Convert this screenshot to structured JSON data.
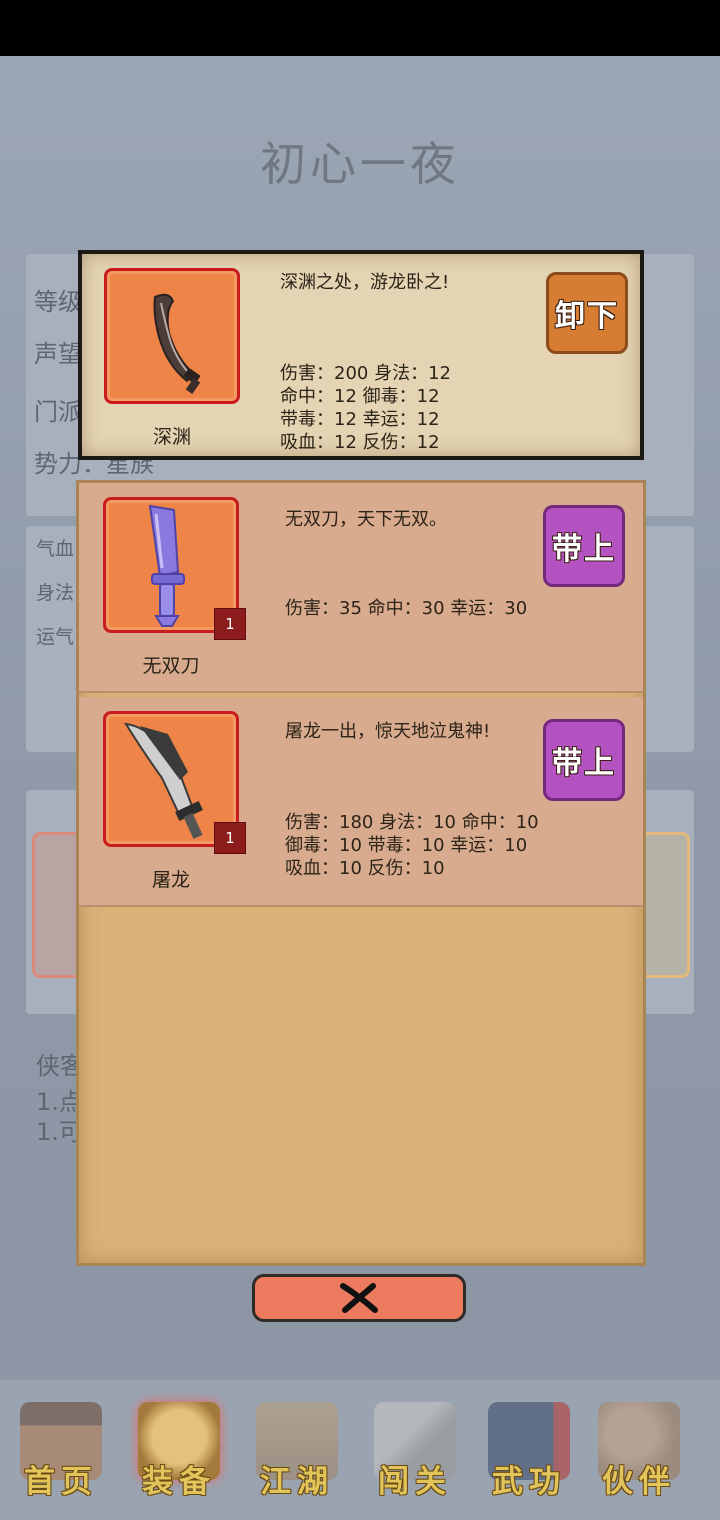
{
  "background": {
    "title": "初心一夜",
    "info_labels": [
      "等级",
      "声望",
      "门派",
      "势力：星族"
    ],
    "attr_labels": [
      "气血",
      "身法",
      "运气"
    ],
    "tips_labels": [
      "侠客",
      "1.点",
      "1.可"
    ]
  },
  "equipped": {
    "name": "深渊",
    "description": "深渊之处，游龙卧之!",
    "stats": [
      "伤害：200 身法：12",
      "命中：12 御毒：12",
      "带毒：12 幸运：12",
      "吸血：12 反伤：12"
    ],
    "action_label": "卸下",
    "icon": "curved-sword-icon"
  },
  "inventory": [
    {
      "name": "无双刀",
      "description": "无双刀，天下无双。",
      "stats": [
        "伤害：35 命中：30 幸运：30"
      ],
      "count": "1",
      "action_label": "带上",
      "icon": "purple-broadsword-icon"
    },
    {
      "name": "屠龙",
      "description": "屠龙一出，惊天地泣鬼神!",
      "stats": [
        "伤害：180 身法：10 命中：10",
        "御毒：10 带毒：10 幸运：10",
        "吸血：10 反伤：10"
      ],
      "count": "1",
      "action_label": "带上",
      "icon": "dragon-saber-icon"
    }
  ],
  "close_icon": "close-x-icon",
  "nav": [
    {
      "label": "首页",
      "icon": "building-icon",
      "active": false
    },
    {
      "label": "装备",
      "icon": "armor-icon",
      "active": true
    },
    {
      "label": "江湖",
      "icon": "scroll-map-icon",
      "active": false
    },
    {
      "label": "闯关",
      "icon": "crossed-swords-icon",
      "active": false
    },
    {
      "label": "武功",
      "icon": "book-icon",
      "active": false
    },
    {
      "label": "伙伴",
      "icon": "companions-icon",
      "active": false
    }
  ],
  "colors": {
    "accent_unequip": "#d77c33",
    "accent_equip": "#b552c2",
    "icon_bg": "#ee8447",
    "icon_border": "#c81c1c",
    "nav_label": "#e1c55b"
  }
}
